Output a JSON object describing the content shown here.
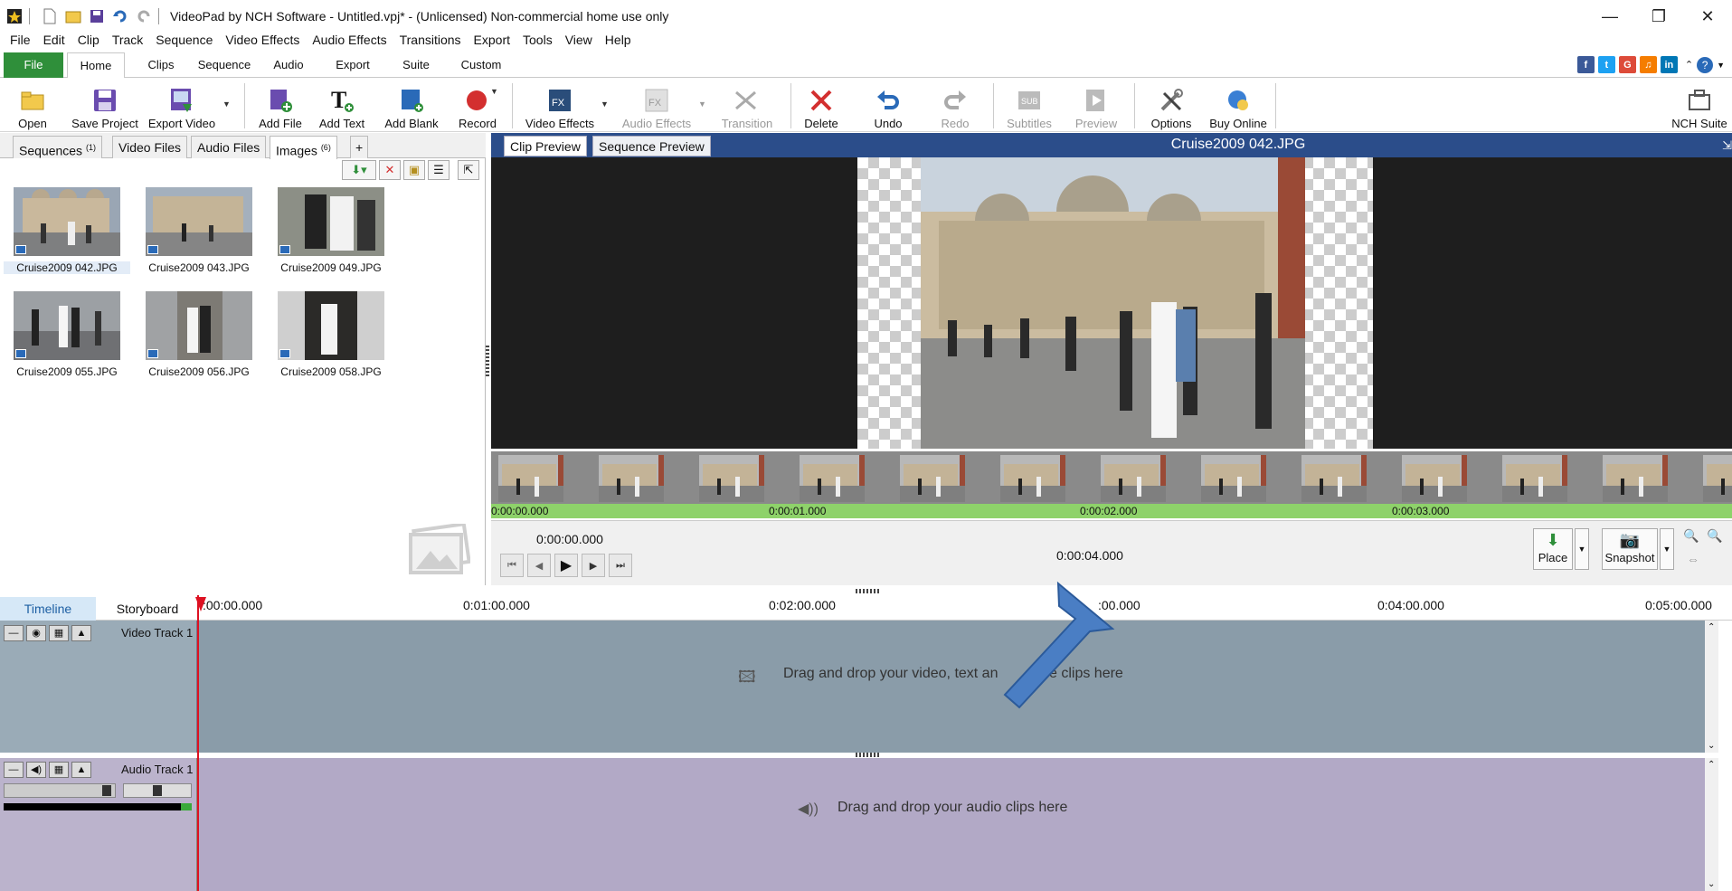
{
  "window": {
    "title": "VideoPad by NCH Software - Untitled.vpj* - (Unlicensed) Non-commercial home use only",
    "minimize": "—",
    "restore": "❐",
    "close": "✕"
  },
  "menu": [
    "File",
    "Edit",
    "Clip",
    "Track",
    "Sequence",
    "Video Effects",
    "Audio Effects",
    "Transitions",
    "Export",
    "Tools",
    "View",
    "Help"
  ],
  "ribbon_tabs": [
    "File",
    "Home",
    "Clips",
    "Sequence",
    "Audio",
    "Export",
    "Suite",
    "Custom"
  ],
  "social": [
    "f",
    "t",
    "G",
    "♫",
    "in"
  ],
  "toolbar": {
    "open": "Open",
    "save_project": "Save Project",
    "export_video": "Export Video",
    "add_file": "Add File",
    "add_text": "Add Text",
    "add_blank": "Add Blank",
    "record": "Record",
    "video_effects": "Video Effects",
    "audio_effects": "Audio Effects",
    "transition": "Transition",
    "delete": "Delete",
    "undo": "Undo",
    "redo": "Redo",
    "subtitles": "Subtitles",
    "preview": "Preview",
    "options": "Options",
    "buy_online": "Buy Online",
    "nch_suite": "NCH Suite"
  },
  "bins": {
    "tabs": [
      {
        "label": "Sequences",
        "count": "(1)"
      },
      {
        "label": "Video Files",
        "count": ""
      },
      {
        "label": "Audio Files",
        "count": ""
      },
      {
        "label": "Images",
        "count": "(6)"
      }
    ],
    "add_tab": "+",
    "images": [
      {
        "name": "Cruise2009 042.JPG"
      },
      {
        "name": "Cruise2009 043.JPG"
      },
      {
        "name": "Cruise2009 049.JPG"
      },
      {
        "name": "Cruise2009 055.JPG"
      },
      {
        "name": "Cruise2009 056.JPG"
      },
      {
        "name": "Cruise2009 058.JPG"
      }
    ]
  },
  "preview": {
    "tab_clip": "Clip Preview",
    "tab_sequence": "Sequence Preview",
    "clip_name": "Cruise2009 042.JPG",
    "ruler": [
      "0:00:00.000",
      "0:00:01.000",
      "0:00:02.000",
      "0:00:03.000"
    ],
    "current_time": "0:00:00.000",
    "duration": "0:00:04.000",
    "place": "Place",
    "snapshot": "Snapshot"
  },
  "timeline": {
    "tab_timeline": "Timeline",
    "tab_storyboard": "Storyboard",
    "ruler": [
      ":00:00.000",
      "0:01:00.000",
      "0:02:00.000",
      ":00.000",
      "0:04:00.000",
      "0:05:00.000"
    ],
    "video_track": "Video Track 1",
    "video_drop": "Drag and drop your video, text an",
    "video_drop_tail": "e clips here",
    "audio_track": "Audio Track 1",
    "audio_drop": "Drag and drop your audio clips here"
  },
  "colors": {
    "preview_header": "#2b4d8a",
    "file_tab": "#2f8f3a",
    "video_track": "#8a9ca9",
    "audio_track": "#b2a9c6",
    "arrow": "#4a7ec4"
  }
}
